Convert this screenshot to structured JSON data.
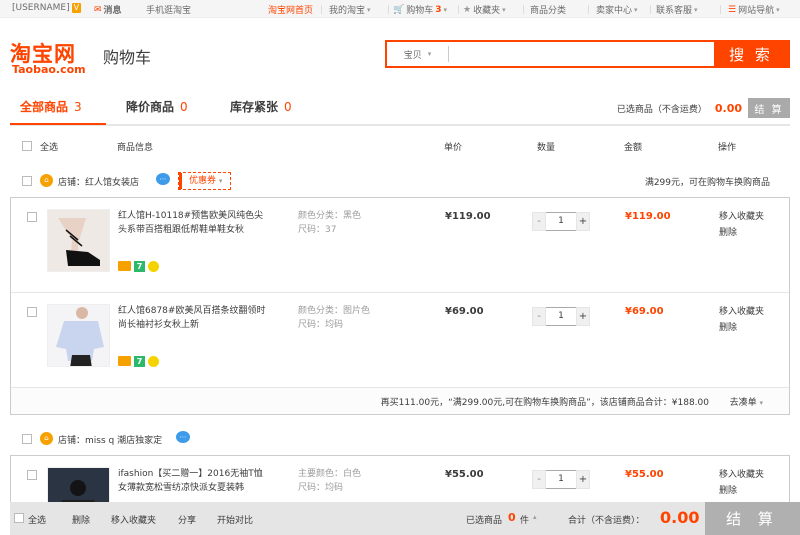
{
  "topbar": {
    "username": "[USERNAME]",
    "vip_badge": "V",
    "messages": "消息",
    "mobile": "手机逛淘宝",
    "home": "淘宝网首页",
    "my_taobao": "我的淘宝",
    "cart_label": "购物车",
    "cart_count": "3",
    "favorites": "收藏夹",
    "categories": "商品分类",
    "seller_center": "卖家中心",
    "contact": "联系客服",
    "site_nav": "网站导航"
  },
  "header": {
    "logo_cn": "淘宝网",
    "logo_en": "Taobao.com",
    "page_title": "购物车",
    "search_category": "宝贝",
    "search_value": "",
    "search_button": "搜 索"
  },
  "tabs": [
    {
      "label": "全部商品",
      "count": "3"
    },
    {
      "label": "降价商品",
      "count": "0"
    },
    {
      "label": "库存紧张",
      "count": "0"
    }
  ],
  "selected_summary": {
    "label": "已选商品（不含运费）",
    "amount": "0.00",
    "settle": "结 算"
  },
  "columns": {
    "select_all": "全选",
    "info": "商品信息",
    "unit_price": "单价",
    "quantity": "数量",
    "amount": "金额",
    "actions": "操作"
  },
  "shops": [
    {
      "label": "店铺：",
      "name": "红人馆女装店",
      "coupon": "优惠券",
      "note": "满299元，可在购物车换购商品",
      "items": [
        {
          "title": "红人馆H-10118#预售欧美风纯色尖头系带百搭粗跟低帮鞋单鞋女秋",
          "attr1": "颜色分类：黑色",
          "attr2": "尺码：37",
          "price": "¥119.00",
          "qty": "1",
          "total": "¥119.00",
          "op1": "移入收藏夹",
          "op2": "删除"
        },
        {
          "title": "红人馆6878#欧美风百搭条纹翻领时尚长袖衬衫女秋上新",
          "attr1": "颜色分类：图片色",
          "attr2": "尺码：均码",
          "price": "¥69.00",
          "qty": "1",
          "total": "¥69.00",
          "op1": "移入收藏夹",
          "op2": "删除"
        }
      ],
      "footer": "再买111.00元，“满299.00元,可在购物车换购商品”，该店铺商品合计：¥188.00",
      "footer_link": "去凑单"
    },
    {
      "label": "店铺：",
      "name": "miss q 潮店独家定",
      "items": [
        {
          "title": "ifashion【买二赠一】2016无袖T恤女薄款宽松雪纺凉快派女夏装韩",
          "attr1": "主要颜色：白色",
          "attr2": "尺码：均码",
          "price": "¥55.00",
          "qty": "1",
          "total": "¥55.00",
          "op1": "移入收藏夹",
          "op2": "删除"
        }
      ]
    }
  ],
  "bottom_bar": {
    "select_all": "全选",
    "delete": "删除",
    "move_fav": "移入收藏夹",
    "share": "分享",
    "coupon": "开始对比",
    "selected_label": "已选商品",
    "selected_count": "0",
    "unit": "件",
    "total_label": "合计（不含运费）：",
    "total": "0.00",
    "settle": "结 算"
  }
}
